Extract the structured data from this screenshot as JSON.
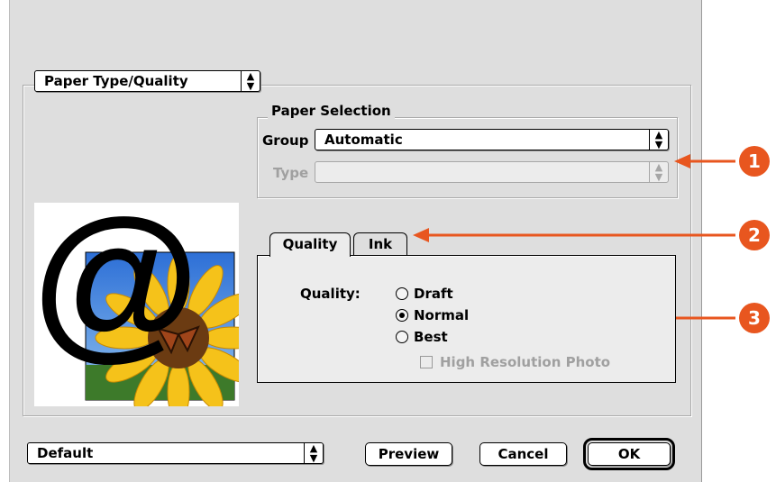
{
  "panel_popup": {
    "label": "Paper Type/Quality"
  },
  "paper_selection": {
    "legend": "Paper Selection",
    "group": {
      "label": "Group",
      "value": "Automatic"
    },
    "type": {
      "label": "Type",
      "value": ""
    }
  },
  "tabs": [
    {
      "label": "Quality",
      "active": true
    },
    {
      "label": "Ink",
      "active": false
    }
  ],
  "quality": {
    "label": "Quality:",
    "options": [
      {
        "label": "Draft",
        "checked": false
      },
      {
        "label": "Normal",
        "checked": true
      },
      {
        "label": "Best",
        "checked": false
      }
    ],
    "high_res": {
      "label": "High Resolution Photo",
      "checked": false
    }
  },
  "footer": {
    "settings_popup": "Default",
    "preview": "Preview",
    "cancel": "Cancel",
    "ok": "OK"
  },
  "callouts": [
    "1",
    "2",
    "3"
  ],
  "colors": {
    "accent": "#e8561f",
    "dialog_bg": "#dedede"
  }
}
